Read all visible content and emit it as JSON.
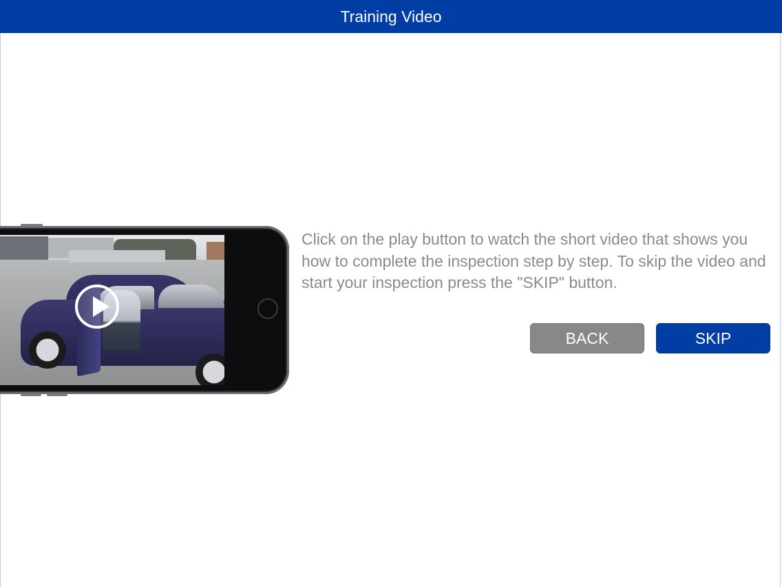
{
  "header": {
    "title": "Training Video"
  },
  "video": {
    "play_icon": "play-icon"
  },
  "instructions": {
    "text": "Click on the play button to watch the short video that shows you how to complete the inspection step by step. To skip the video and start your inspection press the \"SKIP\" button."
  },
  "buttons": {
    "back_label": "BACK",
    "skip_label": "SKIP"
  },
  "colors": {
    "brand_blue": "#003da5",
    "back_gray": "#878889",
    "text_gray": "#8a8a8a"
  }
}
